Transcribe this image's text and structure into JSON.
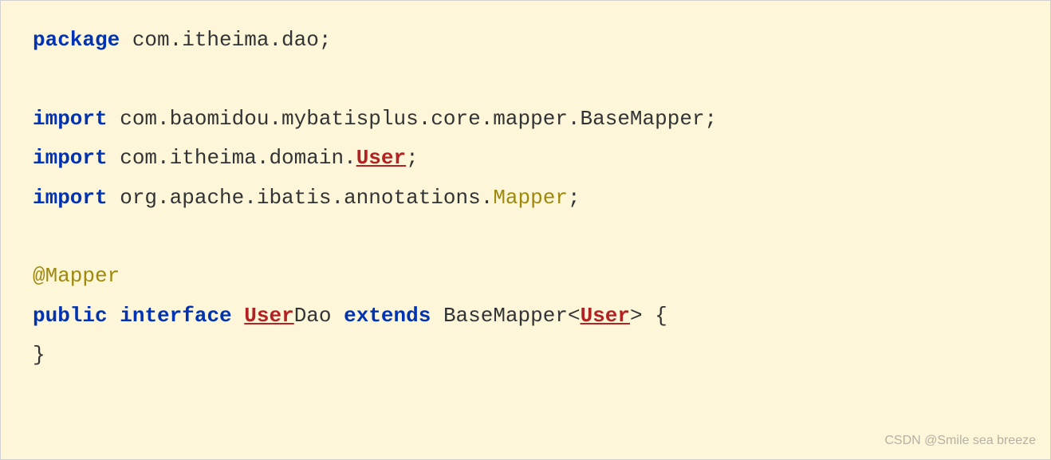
{
  "code": {
    "line1": {
      "kw_package": "package",
      "pkg_name": " com.itheima.dao;"
    },
    "line2": {
      "kw_import": "import",
      "import_path": " com.baomidou.mybatisplus.core.mapper.BaseMapper;"
    },
    "line3": {
      "kw_import": "import",
      "import_prefix": " com.itheima.domain.",
      "import_class": "User",
      "semicolon": ";"
    },
    "line4": {
      "kw_import": "import",
      "import_prefix": " org.apache.ibatis.annotations.",
      "import_class": "Mapper",
      "semicolon": ";"
    },
    "line5": {
      "annotation": "@Mapper"
    },
    "line6": {
      "kw_public": "public",
      "sp1": " ",
      "kw_interface": "interface",
      "sp2": " ",
      "class_err": "User",
      "class_suffix": "Dao ",
      "kw_extends": "extends",
      "sp3": " BaseMapper<",
      "generic_err": "User",
      "closing": "> {"
    },
    "line7": {
      "brace": "}"
    }
  },
  "watermark": "CSDN @Smile sea breeze"
}
